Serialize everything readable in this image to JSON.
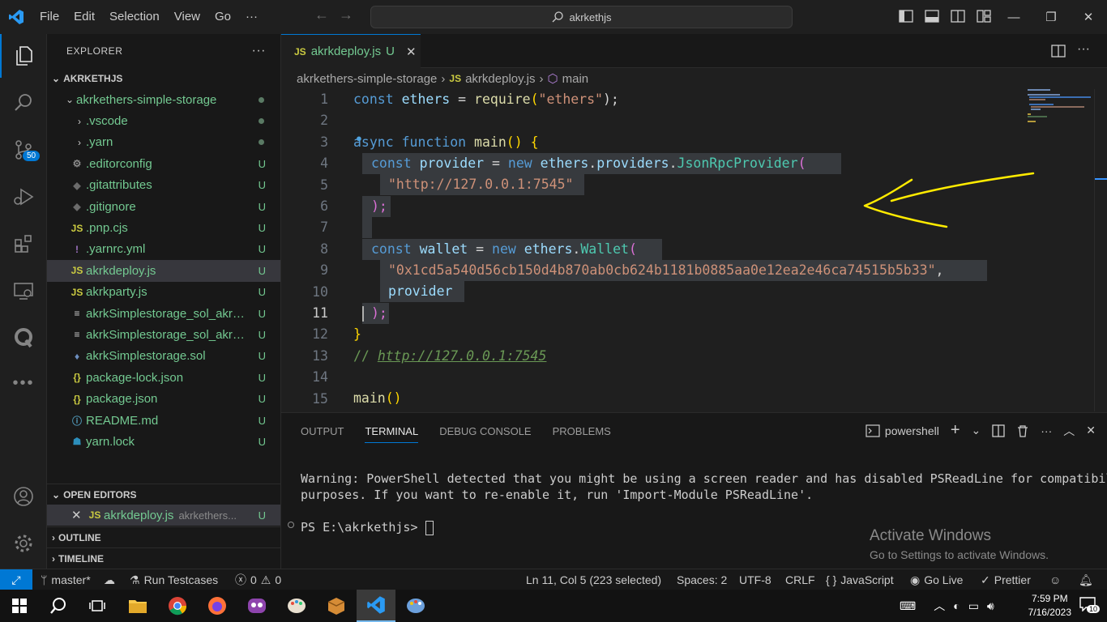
{
  "titlebar": {
    "menu": [
      "File",
      "Edit",
      "Selection",
      "View",
      "Go",
      "···"
    ],
    "search_text": "akrkethjs"
  },
  "activitybar": {
    "scm_badge": "50"
  },
  "explorer": {
    "title": "EXPLORER",
    "workspace": "AKRKETHJS",
    "tree": [
      {
        "name": "akrkethers-simple-storage",
        "kind": "folder-open",
        "status": "dot"
      },
      {
        "name": ".vscode",
        "kind": "folder",
        "status": "dot"
      },
      {
        "name": ".yarn",
        "kind": "folder",
        "status": "dot"
      },
      {
        "name": ".editorconfig",
        "kind": "gear",
        "status": "U"
      },
      {
        "name": ".gitattributes",
        "kind": "diamond",
        "status": "U"
      },
      {
        "name": ".gitignore",
        "kind": "diamond",
        "status": "U"
      },
      {
        "name": ".pnp.cjs",
        "kind": "js",
        "status": "U"
      },
      {
        "name": ".yarnrc.yml",
        "kind": "yml",
        "status": "U"
      },
      {
        "name": "akrkdeploy.js",
        "kind": "js",
        "status": "U"
      },
      {
        "name": "akrkparty.js",
        "kind": "js",
        "status": "U"
      },
      {
        "name": "akrkSimplestorage_sol_akrk...",
        "kind": "lines",
        "status": "U"
      },
      {
        "name": "akrkSimplestorage_sol_akrk...",
        "kind": "lines",
        "status": "U"
      },
      {
        "name": "akrkSimplestorage.sol",
        "kind": "eth",
        "status": "U"
      },
      {
        "name": "package-lock.json",
        "kind": "json",
        "status": "U"
      },
      {
        "name": "package.json",
        "kind": "json",
        "status": "U"
      },
      {
        "name": "README.md",
        "kind": "info",
        "status": "U"
      },
      {
        "name": "yarn.lock",
        "kind": "yarn",
        "status": "U"
      }
    ],
    "open_editors_title": "OPEN EDITORS",
    "open_editor": {
      "name": "akrkdeploy.js",
      "path": "akrkethers...",
      "status": "U"
    },
    "outline_title": "OUTLINE",
    "timeline_title": "TIMELINE"
  },
  "editor": {
    "tab": {
      "name": "akrkdeploy.js",
      "status": "U"
    },
    "breadcrumb": [
      "akrkethers-simple-storage",
      "akrkdeploy.js",
      "main"
    ],
    "line_numbers": [
      "1",
      "2",
      "3",
      "4",
      "5",
      "6",
      "7",
      "8",
      "9",
      "10",
      "11",
      "12",
      "13",
      "14",
      "15"
    ],
    "code": {
      "l1": [
        "const",
        "ethers",
        "=",
        "require",
        "(",
        "\"ethers\"",
        ");"
      ],
      "l3": [
        "async",
        "function",
        "main",
        "()",
        "{"
      ],
      "l4": [
        "const",
        "provider",
        "=",
        "new",
        "ethers",
        ".",
        "providers",
        ".",
        "JsonRpcProvider",
        "("
      ],
      "l5": "\"http://127.0.0.1:7545\"",
      "l6": ");",
      "l8": [
        "const",
        "wallet",
        "=",
        "new",
        "ethers",
        ".",
        "Wallet",
        "("
      ],
      "l9": [
        "\"0x1cd5a540d56cb150d4b870ab0cb624b1181b0885aa0e12ea2e46ca74515b5b33\"",
        ","
      ],
      "l10": "provider",
      "l11": ");",
      "l12": "}",
      "l13": [
        "//",
        "http://127.0.0.1:7545"
      ],
      "l15": [
        "main",
        "()"
      ]
    }
  },
  "panel": {
    "tabs": [
      "OUTPUT",
      "TERMINAL",
      "DEBUG CONSOLE",
      "PROBLEMS"
    ],
    "shell": "powershell",
    "terminal_lines": [
      "Warning: PowerShell detected that you might be using a screen reader and has disabled PSReadLine for compatibil",
      "purposes. If you want to re-enable it, run 'Import-Module PSReadLine'.",
      "PS E:\\akrkethjs> "
    ],
    "watermark_title": "Activate Windows",
    "watermark_sub": "Go to Settings to activate Windows."
  },
  "statusbar": {
    "branch": "master*",
    "run_testcases": "Run Testcases",
    "errors": "0",
    "warnings": "0",
    "position": "Ln 11, Col 5 (223 selected)",
    "spaces": "Spaces: 2",
    "encoding": "UTF-8",
    "eol": "CRLF",
    "language": "JavaScript",
    "golive": "Go Live",
    "prettier": "Prettier"
  },
  "taskbar": {
    "time": "7:59 PM",
    "date": "7/16/2023",
    "notifications": "10"
  },
  "colors": {
    "accent": "#0078d4",
    "git_untracked": "#73c991",
    "annotation": "#ffeb00"
  }
}
